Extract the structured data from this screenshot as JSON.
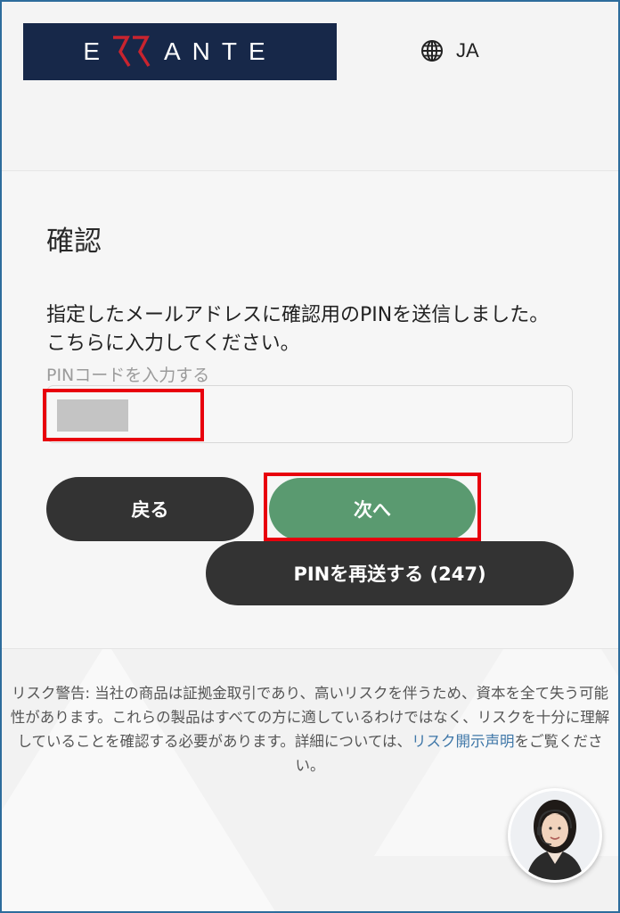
{
  "header": {
    "logo_text": "ERRANTE",
    "logo_bg": "#172849",
    "logo_accent": "#c8242f",
    "language": "JA",
    "language_icon": "globe-icon"
  },
  "form": {
    "title": "確認",
    "description": "指定したメールアドレスに確認用のPINを送信しました。こちらに入力してください。",
    "pin_label": "PINコードを入力する",
    "pin_value": ""
  },
  "buttons": {
    "back": "戻る",
    "next": "次へ",
    "resend": "PINを再送する (247)"
  },
  "footer": {
    "risk_text": "リスク警告: 当社の商品は証拠金取引であり、高いリスクを伴うため、資本を全て失う可能性があります。これらの製品はすべての方に適しているわけではなく、リスクを十分に理解していることを確認する必要があります。詳細については、",
    "risk_link": "リスク開示声明",
    "risk_suffix": "をご覧ください。"
  },
  "support": {
    "icon": "support-agent-avatar"
  },
  "colors": {
    "next_button": "#5a9a70",
    "dark_button": "#333333",
    "highlight": "#e8000d",
    "link": "#3f77a8"
  }
}
